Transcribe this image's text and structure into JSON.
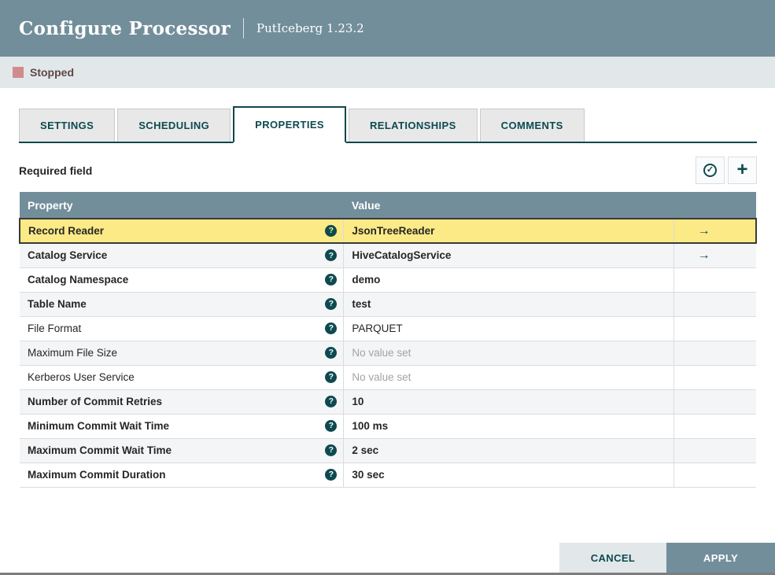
{
  "header": {
    "title": "Configure Processor",
    "subtitle": "PutIceberg 1.23.2"
  },
  "status": {
    "label": "Stopped",
    "color": "#D08C8C"
  },
  "tabs": [
    {
      "label": "SETTINGS",
      "active": false
    },
    {
      "label": "SCHEDULING",
      "active": false
    },
    {
      "label": "PROPERTIES",
      "active": true
    },
    {
      "label": "RELATIONSHIPS",
      "active": false
    },
    {
      "label": "COMMENTS",
      "active": false
    }
  ],
  "toolbar": {
    "required_label": "Required field",
    "verify_icon": "circle-check",
    "add_icon": "plus",
    "verify_glyph": "✓",
    "plus_glyph": "+"
  },
  "table": {
    "headers": {
      "property": "Property",
      "value": "Value"
    },
    "goto_glyph": "→",
    "help_glyph": "?",
    "rows": [
      {
        "property": "Record Reader",
        "value": "JsonTreeReader",
        "required": true,
        "has_link": true,
        "selected": true,
        "value_set": true
      },
      {
        "property": "Catalog Service",
        "value": "HiveCatalogService",
        "required": true,
        "has_link": true,
        "selected": false,
        "value_set": true
      },
      {
        "property": "Catalog Namespace",
        "value": "demo",
        "required": true,
        "has_link": false,
        "selected": false,
        "value_set": true
      },
      {
        "property": "Table Name",
        "value": "test",
        "required": true,
        "has_link": false,
        "selected": false,
        "value_set": true
      },
      {
        "property": "File Format",
        "value": "PARQUET",
        "required": false,
        "has_link": false,
        "selected": false,
        "value_set": true
      },
      {
        "property": "Maximum File Size",
        "value": "No value set",
        "required": false,
        "has_link": false,
        "selected": false,
        "value_set": false
      },
      {
        "property": "Kerberos User Service",
        "value": "No value set",
        "required": false,
        "has_link": false,
        "selected": false,
        "value_set": false
      },
      {
        "property": "Number of Commit Retries",
        "value": "10",
        "required": true,
        "has_link": false,
        "selected": false,
        "value_set": true
      },
      {
        "property": "Minimum Commit Wait Time",
        "value": "100 ms",
        "required": true,
        "has_link": false,
        "selected": false,
        "value_set": true
      },
      {
        "property": "Maximum Commit Wait Time",
        "value": "2 sec",
        "required": true,
        "has_link": false,
        "selected": false,
        "value_set": true
      },
      {
        "property": "Maximum Commit Duration",
        "value": "30 sec",
        "required": true,
        "has_link": false,
        "selected": false,
        "value_set": true
      }
    ]
  },
  "footer": {
    "cancel_label": "CANCEL",
    "apply_label": "APPLY"
  },
  "colors": {
    "header_bg": "#728E9B",
    "accent_teal": "#0D4A50",
    "selected_row_bg": "#FBEA86",
    "status_bar_bg": "#E2E7EA",
    "alt_row_bg": "#F4F5F7"
  }
}
